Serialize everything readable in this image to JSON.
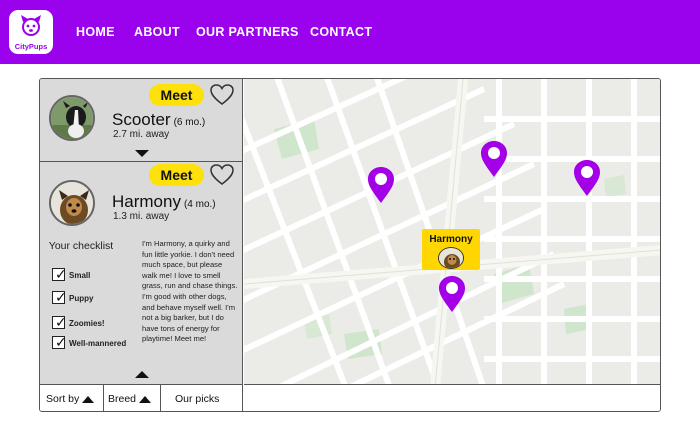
{
  "brand": {
    "name": "CityPups",
    "color": "#9a02ee"
  },
  "nav": [
    "HOME",
    "ABOUT",
    "OUR PARTNERS",
    "CONTACT"
  ],
  "dogs": [
    {
      "name": "Scooter",
      "age": "(6 mo.)",
      "distance": "2.7 mi. away",
      "meet_label": "Meet"
    },
    {
      "name": "Harmony",
      "age": "(4 mo.)",
      "distance": "1.3 mi. away",
      "meet_label": "Meet",
      "checklist_title": "Your checklist",
      "checklist": [
        "Small",
        "Puppy",
        "Zoomies!",
        "Well-mannered"
      ],
      "bio": "I'm Harmony, a quirky and fun little yorkie. I don't need much space, but please walk me! I love to smell grass, run and chase things. I'm good with other dogs, and behave myself well. I'm not a big barker, but I do have tons of energy for playtime! Meet me!"
    }
  ],
  "bottom_tabs": [
    "Sort by",
    "Breed",
    "Our picks"
  ],
  "map": {
    "popup_label": "Harmony",
    "pin_color": "#a300e8",
    "popup_color": "#ffd600"
  },
  "colors": {
    "meet": "#ffe10a",
    "sidebar": "#dadadb"
  }
}
